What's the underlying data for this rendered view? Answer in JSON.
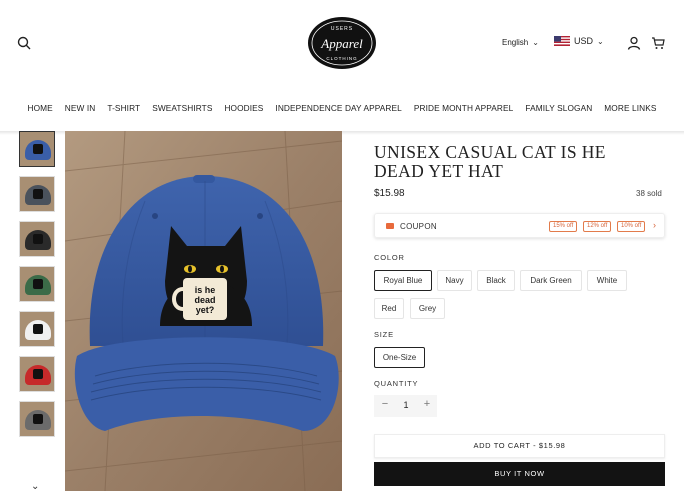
{
  "header": {
    "logo_text_top": "USERS",
    "logo_text_main": "Apparel",
    "logo_text_bottom": "CLOTHING",
    "language": "English",
    "currency": "USD"
  },
  "nav": [
    "HOME",
    "NEW IN",
    "T-SHIRT",
    "SWEATSHIRTS",
    "HOODIES",
    "INDEPENDENCE DAY APPAREL",
    "PRIDE MONTH APPAREL",
    "FAMILY SLOGAN",
    "MORE LINKS"
  ],
  "thumbnails": [
    {
      "color": "#3a5ea8",
      "cat": true
    },
    {
      "color": "#4a525c",
      "cat": true
    },
    {
      "color": "#2a2a2a",
      "cat": true
    },
    {
      "color": "#3b6b48",
      "cat": true
    },
    {
      "color": "#f0f0f0",
      "cat": true
    },
    {
      "color": "#c62a2a",
      "cat": true
    },
    {
      "color": "#6b6b6b",
      "cat": true
    }
  ],
  "product": {
    "title": "UNISEX CASUAL CAT IS HE DEAD YET HAT",
    "price": "$15.98",
    "sold": "38 sold",
    "mug_text": [
      "is he",
      "dead",
      "yet?"
    ]
  },
  "coupon": {
    "label": "COUPON",
    "tags": [
      "15% off",
      "12% off",
      "10% off"
    ]
  },
  "color": {
    "label": "COLOR",
    "options": [
      "Royal Blue",
      "Navy",
      "Black",
      "Dark Green",
      "White",
      "Red",
      "Grey"
    ],
    "selected": "Royal Blue"
  },
  "size": {
    "label": "SIZE",
    "options": [
      "One-Size"
    ],
    "selected": "One-Size"
  },
  "quantity": {
    "label": "QUANTITY",
    "minus": "−",
    "value": "1",
    "plus": "+"
  },
  "buttons": {
    "add_to_cart": "ADD TO CART - $15.98",
    "buy_now": "BUY IT NOW"
  },
  "colors": {
    "accent_coupon": "#e27b4b",
    "cap_blue": "#3a5ea8",
    "button_dark": "#131313"
  }
}
